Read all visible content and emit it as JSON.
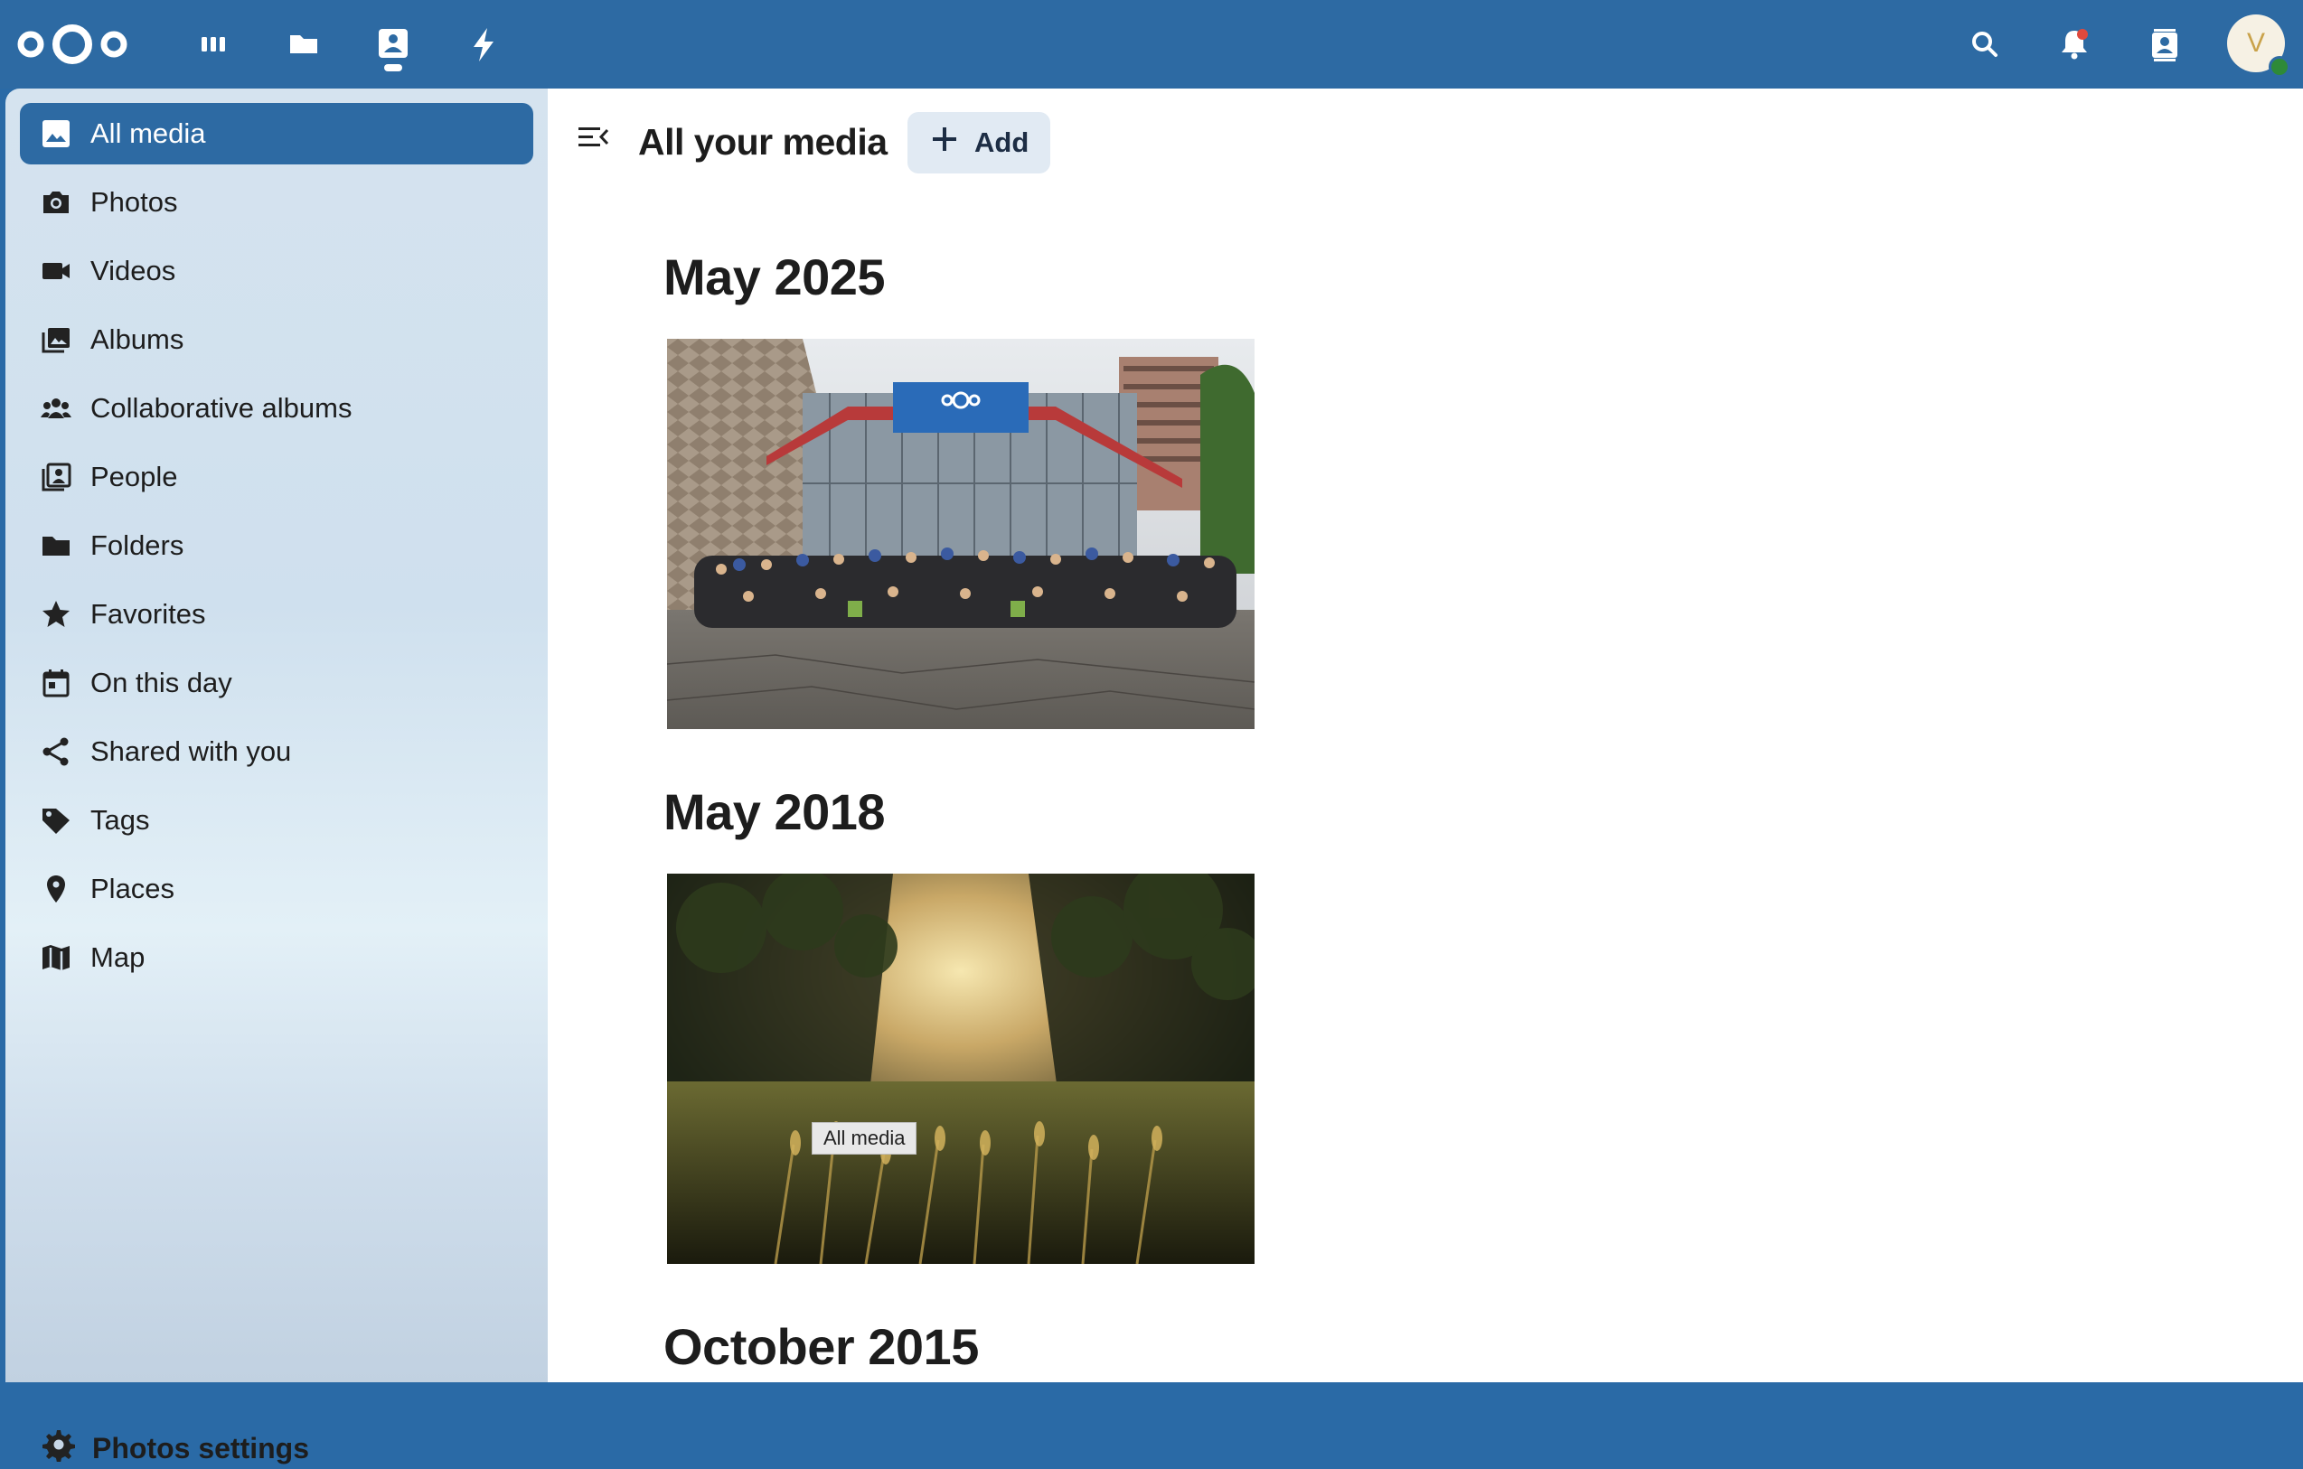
{
  "header": {
    "logo": "nextcloud-logo",
    "apps": [
      "dashboard-icon",
      "files-icon",
      "photos-icon",
      "activity-icon"
    ],
    "right_icons": [
      "search-icon",
      "notifications-icon",
      "contacts-icon"
    ],
    "avatar_initial": "V"
  },
  "sidebar": {
    "items": [
      {
        "label": "All media",
        "icon": "image-icon",
        "active": true
      },
      {
        "label": "Photos",
        "icon": "camera-icon"
      },
      {
        "label": "Videos",
        "icon": "video-icon"
      },
      {
        "label": "Albums",
        "icon": "albums-icon"
      },
      {
        "label": "Collaborative albums",
        "icon": "people-group-icon"
      },
      {
        "label": "People",
        "icon": "person-portrait-icon"
      },
      {
        "label": "Folders",
        "icon": "folder-icon"
      },
      {
        "label": "Favorites",
        "icon": "star-icon"
      },
      {
        "label": "On this day",
        "icon": "calendar-icon"
      },
      {
        "label": "Shared with you",
        "icon": "share-icon"
      },
      {
        "label": "Tags",
        "icon": "tag-icon"
      },
      {
        "label": "Places",
        "icon": "map-marker-icon"
      },
      {
        "label": "Map",
        "icon": "map-icon"
      }
    ],
    "settings_label": "Photos settings"
  },
  "main": {
    "title": "All your media",
    "add_label": "Add",
    "sections": [
      {
        "title": "May 2025"
      },
      {
        "title": "May 2018"
      },
      {
        "title": "October 2015"
      }
    ],
    "tooltip": "All media"
  },
  "colors": {
    "header": "#2d6aa3",
    "active_item": "#2d6aa3",
    "add_button_bg": "#e1eaf3"
  }
}
